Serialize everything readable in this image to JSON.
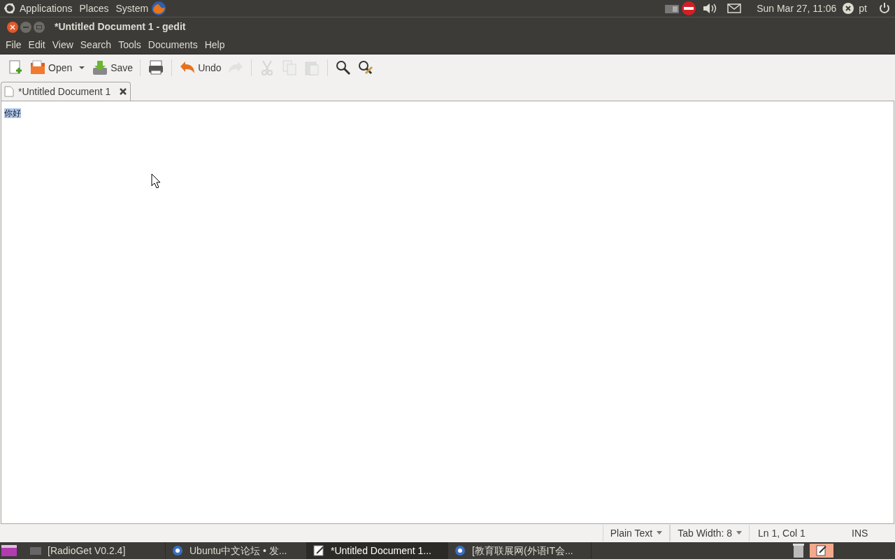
{
  "top_panel": {
    "menus": [
      "Applications",
      "Places",
      "System"
    ],
    "clock": "Sun Mar 27, 11:06",
    "user": "pt"
  },
  "window": {
    "title": "*Untitled Document 1 - gedit"
  },
  "menu": [
    "File",
    "Edit",
    "View",
    "Search",
    "Tools",
    "Documents",
    "Help"
  ],
  "toolbar": [
    {
      "kind": "button",
      "disabled": false
    },
    {
      "kind": "button",
      "label": "Open",
      "disabled": false
    },
    {
      "kind": "dropdown"
    },
    {
      "kind": "button",
      "label": "Save",
      "disabled": false
    },
    {
      "kind": "separator"
    },
    {
      "kind": "button",
      "disabled": false
    },
    {
      "kind": "separator"
    },
    {
      "kind": "button",
      "label": "Undo",
      "disabled": false
    },
    {
      "kind": "button",
      "disabled": true
    },
    {
      "kind": "separator"
    },
    {
      "kind": "button",
      "disabled": true
    },
    {
      "kind": "button",
      "disabled": true
    },
    {
      "kind": "button",
      "disabled": true
    },
    {
      "kind": "separator"
    },
    {
      "kind": "button",
      "disabled": false
    },
    {
      "kind": "button",
      "disabled": false
    }
  ],
  "tabs": [
    {
      "label": "*Untitled Document 1",
      "selected": true
    }
  ],
  "editor": {
    "text": "你好",
    "selected": true
  },
  "status_bar": {
    "language": "Plain Text",
    "tab_width": "Tab Width:  8",
    "position": "Ln 1, Col 1",
    "mode": "INS"
  },
  "taskbar": [
    {
      "label": "[RadioGet V0.2.4]",
      "selected": false
    },
    {
      "label": "Ubuntu中文论坛 • 发...",
      "selected": false
    },
    {
      "label": "*Untitled Document 1...",
      "selected": true
    },
    {
      "label": "[教育联展网(外语IT会...",
      "selected": false
    }
  ]
}
